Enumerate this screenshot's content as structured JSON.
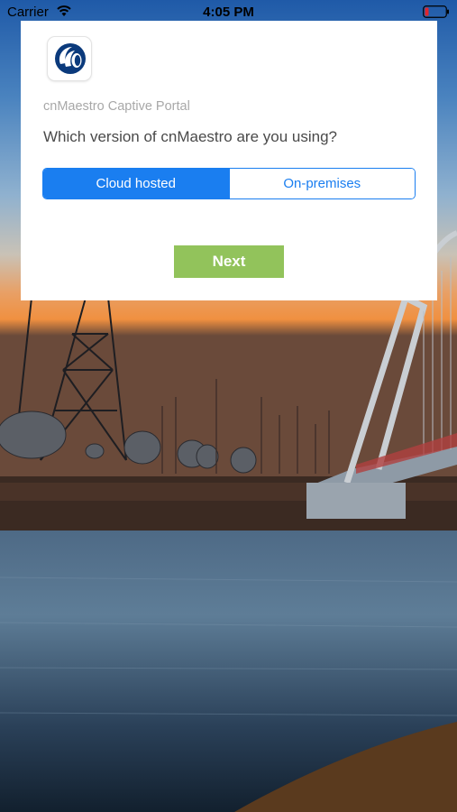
{
  "status_bar": {
    "carrier": "Carrier",
    "time": "4:05 PM",
    "wifi_icon": "wifi-icon",
    "battery_icon": "battery-low-icon",
    "battery_color": "#e0262e"
  },
  "card": {
    "logo_icon": "cnmaestro-logo-icon",
    "app_title": "cnMaestro Captive Portal",
    "question": "Which version of cnMaestro are you using?",
    "options": [
      {
        "label": "Cloud hosted",
        "selected": true
      },
      {
        "label": "On-premises",
        "selected": false
      }
    ],
    "next_label": "Next"
  },
  "colors": {
    "accent": "#1a7ef0",
    "next_button": "#92c35b",
    "card_background": "#ffffff"
  }
}
